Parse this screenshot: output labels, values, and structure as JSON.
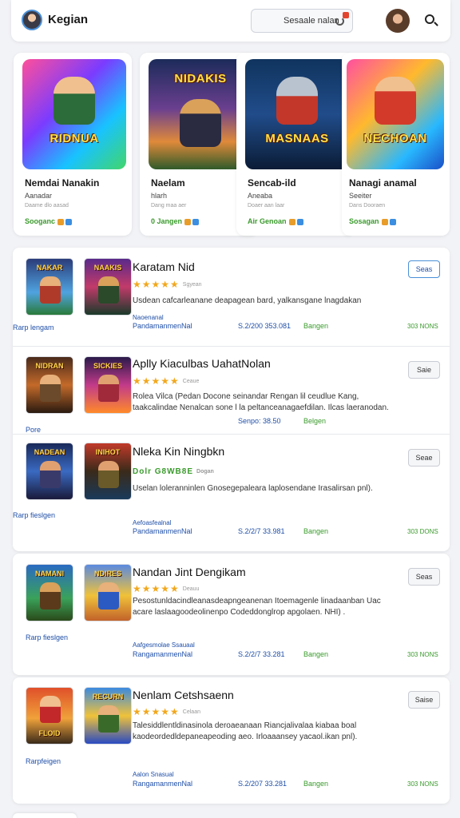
{
  "header": {
    "brand": "Kegian",
    "search_placeholder": "Sesaale nalan",
    "icons": [
      "brand-avatar",
      "refresh-icon",
      "user-avatar",
      "search-icon"
    ]
  },
  "featured": [
    {
      "image_title": "RIDNUA",
      "title": "Nemdai Nanakin",
      "subtitle": "Aanadar",
      "meta": "Daame dlo aasad",
      "price": "Sooganc"
    },
    {
      "image_title": "NIDAKIS",
      "title": "Naelam",
      "subtitle": "hlarh",
      "meta": "Dang maa aer",
      "price": "0 Jangen"
    },
    {
      "image_title": "MASNAAS",
      "title": "Sencab-ild",
      "subtitle": "Aneaba",
      "meta": "Doaer aan laar",
      "price": "Air Genoan"
    },
    {
      "image_title": "NECHOAN",
      "title": "Nanagi anamal",
      "subtitle": "Seeiter",
      "meta": "Dans Dooraen",
      "price": "Sosagan"
    }
  ],
  "list": [
    {
      "thumbs": [
        "NAKAR",
        "NAAKIS"
      ],
      "caption": "Rarp lengam",
      "title": "Karatam Nid",
      "stars": "★★★★★",
      "rating_meta": "Sgyean",
      "desc": "Usdean cafcarleanane deapagean bard, yalkansgane lnagdakan",
      "link1": "Naoenanal",
      "link2": "PandamanmenNal",
      "date": "S.2/200 353.081",
      "status": "Bangen",
      "count": "303 NONS",
      "button": "Seas",
      "button_active": true
    },
    {
      "thumbs": [
        "NIDRAN",
        "SICKIES"
      ],
      "caption": "Pore",
      "title": "Aplly Kiaculbas UahatNolan",
      "stars": "★★★★★",
      "rating_meta": "Ceaue",
      "desc": "Rolea Vilca (Pedan Docone seinandar Rengan lil ceudlue Kang, taakcalindae Nenalcan sone l la peltanceanagaefdilan. Ilcas laeranodan.",
      "link1": "",
      "link2": "",
      "date": "Senpo: 38.50",
      "status": "Belgen",
      "count": "",
      "button": "Saie",
      "button_active": false
    },
    {
      "thumbs": [
        "NADEAN",
        "INIHOT"
      ],
      "caption": "Rarp fieslgen",
      "title": "Nleka Kin Ningbkn",
      "stars": "Dolr G8WB8E",
      "rating_meta": "Dogan",
      "desc": "Uselan loleranninlen Gnosegepaleara laplosendane Irasalirsan pnl).",
      "link1": "Aefoasfealnal",
      "link2": "PandamanmenNal",
      "date": "S.2/2/7 33.981",
      "status": "Bangen",
      "count": "303 DONS",
      "button": "Seae",
      "button_active": false
    },
    {
      "thumbs": [
        "NAMANI",
        "NDIRES"
      ],
      "caption": "Rarp fieslgen",
      "title": "Nandan Jint Dengikam",
      "stars": "★★★★★",
      "rating_meta": "Deauu",
      "desc": "Pesostunldacindleanasdeapngeanenan Itoemagenle linadaanban Uac acare laslaagoodeolinenpo Codeddonglrop apgolaen. NHI) .",
      "link1": "Aafgesmolae Ssauaal",
      "link2": "RangamanmenNal",
      "date": "S.2/2/7 33.281",
      "status": "Bangen",
      "count": "303 NONS",
      "button": "Seas",
      "button_active": false
    },
    {
      "thumbs": [
        "FLOID",
        "RECURN"
      ],
      "caption": "Rarpfeigen",
      "title": "Nenlam Cetshsaenn",
      "stars": "★★★★★",
      "rating_meta": "Celaan",
      "desc": "Talesiddlentldinasinola deroaeanaan Riancjalivalaa kiabaa boal kaodeordedldepaneapeoding aeo. Irloaaansey yacaol.ikan pnl).",
      "link1": "Aalon Snasual",
      "link2": "RangamanmenNal",
      "date": "S.2/207 33.281",
      "status": "Bangen",
      "count": "303 NONS",
      "button": "Saise",
      "button_active": false
    }
  ]
}
